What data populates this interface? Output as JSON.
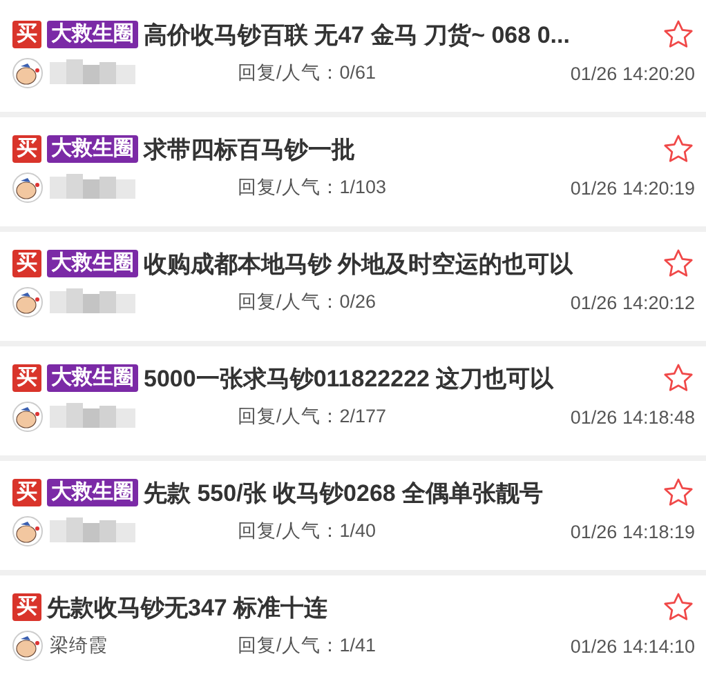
{
  "posts": [
    {
      "tags": [
        {
          "kind": "type",
          "text": "买"
        },
        {
          "kind": "group",
          "text": "大救生圈"
        }
      ],
      "title": "高价收马钞百联 无47 金马 刀货~ 068 0...",
      "starred": false,
      "user_blurred": true,
      "stats": "回复/人气：0/61",
      "time": "01/26 14:20:20"
    },
    {
      "tags": [
        {
          "kind": "type",
          "text": "买"
        },
        {
          "kind": "group",
          "text": "大救生圈"
        }
      ],
      "title": "求带四标百马钞一批",
      "starred": false,
      "user_blurred": true,
      "stats": "回复/人气：1/103",
      "time": "01/26 14:20:19"
    },
    {
      "tags": [
        {
          "kind": "type",
          "text": "买"
        },
        {
          "kind": "group",
          "text": "大救生圈"
        }
      ],
      "title": "收购成都本地马钞 外地及时空运的也可以",
      "starred": false,
      "user_blurred": true,
      "stats": "回复/人气：0/26",
      "time": "01/26 14:20:12"
    },
    {
      "tags": [
        {
          "kind": "type",
          "text": "买"
        },
        {
          "kind": "group",
          "text": "大救生圈"
        }
      ],
      "title": "5000一张求马钞011822222 这刀也可以",
      "starred": false,
      "user_blurred": true,
      "stats": "回复/人气：2/177",
      "time": "01/26 14:18:48"
    },
    {
      "tags": [
        {
          "kind": "type",
          "text": "买"
        },
        {
          "kind": "group",
          "text": "大救生圈"
        }
      ],
      "title": "先款 550/张 收马钞0268 全偶单张靓号",
      "starred": false,
      "user_blurred": true,
      "stats": "回复/人气：1/40",
      "time": "01/26 14:18:19"
    },
    {
      "tags": [
        {
          "kind": "type",
          "text": "买"
        }
      ],
      "title": "先款收马钞无347 标准十连",
      "starred": false,
      "user_blurred": false,
      "user": "梁绮霞",
      "stats": "回复/人气：1/41",
      "time": "01/26 14:14:10"
    }
  ]
}
